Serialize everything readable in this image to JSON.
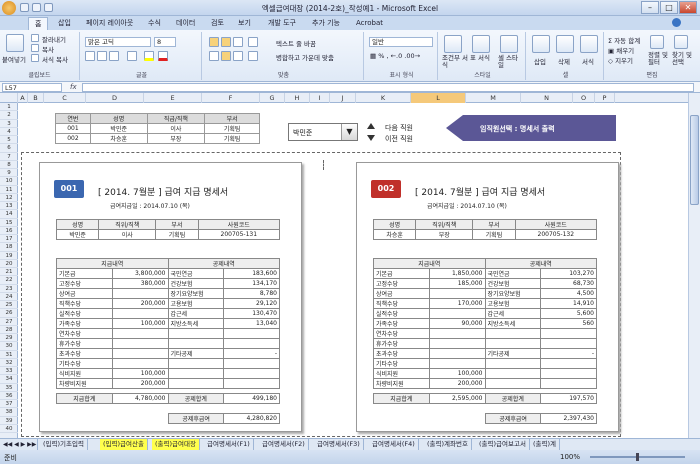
{
  "window": {
    "title": "엑셀급여대장 (2014-2호)_작성예1 - Microsoft Excel"
  },
  "tabs": [
    "홈",
    "삽입",
    "페이지 레이아웃",
    "수식",
    "데이터",
    "검토",
    "보기",
    "개발 도구",
    "추가 기능",
    "Acrobat"
  ],
  "ribbon": {
    "paste": "붙여넣기",
    "cut": "잘라내기",
    "copy": "복사",
    "painter": "서식 복사",
    "clipboard": "클립보드",
    "font_name": "맑은 고딕",
    "font_size": "8",
    "font": "글꼴",
    "wrap": "텍스트 줄 바꿈",
    "merge": "병합하고 가운데 맞춤",
    "align": "맞춤",
    "numfmt": "일반",
    "number": "표시 형식",
    "cond": "조건부 서식",
    "tblfmt": "표 서식",
    "cellstyle": "셀 스타일",
    "styles": "스타일",
    "insert": "삽입",
    "delete": "삭제",
    "format": "서식",
    "cells": "셀",
    "sum": "자동 합계",
    "fill": "채우기",
    "clear": "지우기",
    "sortfilter": "정렬 및 필터",
    "findselect": "찾기 및 선택",
    "editing": "편집"
  },
  "namebox": "L57",
  "columns": [
    "A",
    "B",
    "C",
    "D",
    "E",
    "F",
    "G",
    "H",
    "I",
    "J",
    "K",
    "L",
    "M",
    "N",
    "O",
    "P"
  ],
  "rows": [
    "1",
    "2",
    "3",
    "4",
    "5",
    "6",
    "7",
    "8",
    "9",
    "10",
    "11",
    "12",
    "13",
    "14",
    "15",
    "16",
    "17",
    "18",
    "19",
    "20",
    "21",
    "22",
    "23",
    "24",
    "25",
    "26",
    "27",
    "28",
    "29",
    "30",
    "31",
    "32",
    "33",
    "34",
    "35",
    "36",
    "37",
    "38",
    "39",
    "40"
  ],
  "emp_list": {
    "headers": [
      "연번",
      "성명",
      "직급/직책",
      "부서"
    ],
    "rows": [
      [
        "001",
        "박민준",
        "이사",
        "기획팀"
      ],
      [
        "002",
        "차승훈",
        "부장",
        "기획팀"
      ]
    ]
  },
  "selector": {
    "value": "박민준",
    "next": "다음 직원",
    "prev": "이전 직원",
    "print": "임직원선택 : 명세서 출력"
  },
  "slips": [
    {
      "no": "001",
      "title": "[ 2014. 7월분 ]  급여 지급 명세서",
      "date": "급여지급일 : 2014.07.10 (목)",
      "info_headers": [
        "성명",
        "직위/직책",
        "부서",
        "사원코드"
      ],
      "info": [
        "박민준",
        "이사",
        "기획팀",
        "200705-131"
      ],
      "pay_header": "지급내역",
      "ded_header": "공제내역",
      "rows": [
        [
          "기본급",
          "3,800,000",
          "국민연금",
          "183,600"
        ],
        [
          "고정수당",
          "380,000",
          "건강보험",
          "134,170"
        ],
        [
          "상여금",
          "",
          "장기요양보험",
          "8,780"
        ],
        [
          "직책수당",
          "200,000",
          "고용보험",
          "29,120"
        ],
        [
          "실적수당",
          "",
          "갑근세",
          "130,470"
        ],
        [
          "가족수당",
          "100,000",
          "지방소득세",
          "13,040"
        ],
        [
          "연차수당",
          "",
          "",
          ""
        ],
        [
          "휴가수당",
          "",
          "",
          ""
        ],
        [
          "초과수당",
          "",
          "기타공제",
          "-"
        ],
        [
          "기타수당",
          "",
          "",
          ""
        ],
        [
          "식비지원",
          "100,000",
          "",
          ""
        ],
        [
          "차량비지원",
          "200,000",
          "",
          ""
        ]
      ],
      "total_pay_label": "지급합계",
      "total_pay": "4,780,000",
      "total_ded_label": "공제합계",
      "total_ded": "499,180",
      "net_label": "공제후급여",
      "net": "4,280,820"
    },
    {
      "no": "002",
      "title": "[ 2014. 7월분 ]  급여 지급 명세서",
      "date": "급여지급일 : 2014.07.10 (목)",
      "info_headers": [
        "성명",
        "직위/직책",
        "부서",
        "사원코드"
      ],
      "info": [
        "차승훈",
        "부장",
        "기획팀",
        "200705-132"
      ],
      "pay_header": "지급내역",
      "ded_header": "공제내역",
      "rows": [
        [
          "기본급",
          "1,850,000",
          "국민연금",
          "103,270"
        ],
        [
          "고정수당",
          "185,000",
          "건강보험",
          "68,730"
        ],
        [
          "상여금",
          "",
          "장기요양보험",
          "4,500"
        ],
        [
          "직책수당",
          "170,000",
          "고용보험",
          "14,910"
        ],
        [
          "실적수당",
          "",
          "갑근세",
          "5,600"
        ],
        [
          "가족수당",
          "90,000",
          "지방소득세",
          "560"
        ],
        [
          "연차수당",
          "",
          "",
          ""
        ],
        [
          "휴가수당",
          "",
          "",
          ""
        ],
        [
          "초과수당",
          "",
          "기타공제",
          "-"
        ],
        [
          "기타수당",
          "",
          "",
          ""
        ],
        [
          "식비지원",
          "100,000",
          "",
          ""
        ],
        [
          "차량비지원",
          "200,000",
          "",
          ""
        ]
      ],
      "total_pay_label": "지급합계",
      "total_pay": "2,595,000",
      "total_ded_label": "공제합계",
      "total_ded": "197,570",
      "net_label": "공제후급여",
      "net": "2,397,430"
    }
  ],
  "sheet_tabs": [
    "(입력)기초입력",
    "(입력)급여산출",
    "(출력)급여대장",
    "급여명세서(F1)",
    "급여명세서(F2)",
    "급여명세서(F3)",
    "급여명세서(F4)",
    "(출력)계좌번호",
    "(출력)급여보고서",
    "(출력)계"
  ],
  "status": "준비",
  "zoom": "100%",
  "colors": {
    "slip1_badge": "#3b67b0",
    "slip2_badge": "#c0302a",
    "print_banner": "#5b5796",
    "selected_col": "#f5c97a",
    "yellow_tab": "#ffff4d"
  }
}
